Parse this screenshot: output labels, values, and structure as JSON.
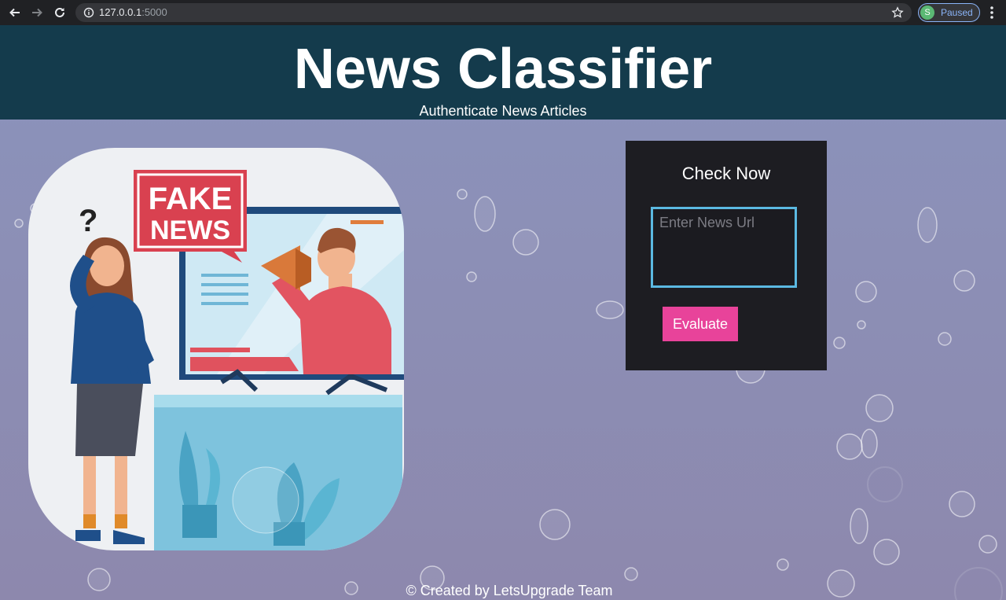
{
  "browser": {
    "url_host": "127.0.0.1",
    "url_port": ":5000",
    "profile_initial": "S",
    "profile_status": "Paused"
  },
  "header": {
    "title": "News Classifier",
    "subtitle": "Authenticate News Articles"
  },
  "hero": {
    "sign_line1": "FAKE",
    "sign_line2": "NEWS",
    "question_mark": "?"
  },
  "check_panel": {
    "heading": "Check Now",
    "url_placeholder": "Enter News Url",
    "evaluate_label": "Evaluate"
  },
  "footer": {
    "credit": "© Created by LetsUpgrade Team"
  },
  "colors": {
    "header_bg": "#143b4c",
    "panel_bg": "#1d1d22",
    "input_border": "#5bb9e2",
    "button_bg": "#e8439a"
  }
}
